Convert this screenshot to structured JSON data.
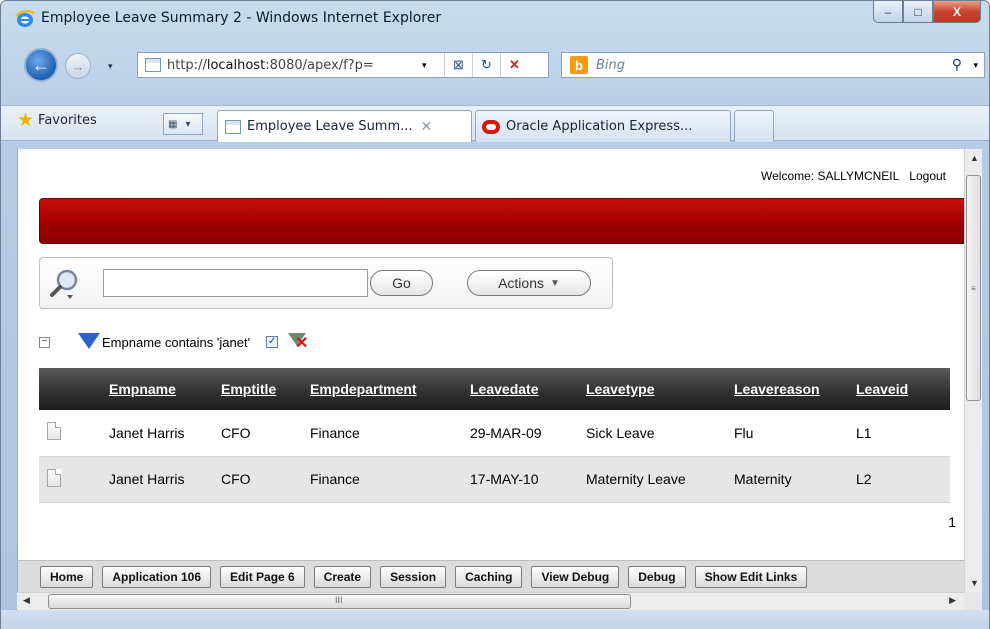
{
  "window": {
    "title": "Employee Leave Summary 2 - Windows Internet Explorer",
    "minimize": "–",
    "maximize": "□",
    "close": "X"
  },
  "nav": {
    "back": "←",
    "forward": "→",
    "dropdown": "▾",
    "url_prefix": "http://",
    "url_host": "localhost",
    "url_rest": ":8080/apex/f?p=",
    "compat": "⊠",
    "refresh": "↻",
    "stop": "✕",
    "search_placeholder": "Bing",
    "search_go": "⚲",
    "search_dropdown": "▾"
  },
  "favorites": {
    "label": "Favorites",
    "star": "★",
    "quicktabs": "▦",
    "quicktabs_dd": "▾",
    "tabs": [
      {
        "label": "Employee Leave Summ...",
        "close": "✕"
      },
      {
        "label": "Oracle Application Express..."
      }
    ]
  },
  "page": {
    "welcome_label": "Welcome: SALLYMCNEIL",
    "logout": "Logout",
    "search": {
      "input_value": "",
      "go": "Go",
      "actions": "Actions",
      "actions_caret": "▼"
    },
    "filter": {
      "collapse": "−",
      "text": "Empname contains 'janet'",
      "check": "✓",
      "remove": "✕"
    },
    "columns": [
      "",
      "Empname",
      "Emptitle",
      "Empdepartment",
      "Leavedate",
      "Leavetype",
      "Leavereason",
      "Leaveid"
    ],
    "rows": [
      [
        "",
        "Janet Harris",
        "CFO",
        "Finance",
        "29-MAR-09",
        "Sick Leave",
        "Flu",
        "L1"
      ],
      [
        "",
        "Janet Harris",
        "CFO",
        "Finance",
        "17-MAY-10",
        "Maternity Leave",
        "Maternity",
        "L2"
      ]
    ],
    "pager": "1"
  },
  "devbar": [
    "Home",
    "Application 106",
    "Edit Page 6",
    "Create",
    "Session",
    "Caching",
    "View Debug",
    "Debug",
    "Show Edit Links"
  ],
  "scroll": {
    "up": "▲",
    "down": "▼",
    "left": "◀",
    "right": "▶",
    "v_grip": "≡",
    "h_grip": "III"
  },
  "colors": {
    "banner": "#a10000",
    "header_bg": "#2f2f2f",
    "even_row": "#e6e6e6"
  }
}
